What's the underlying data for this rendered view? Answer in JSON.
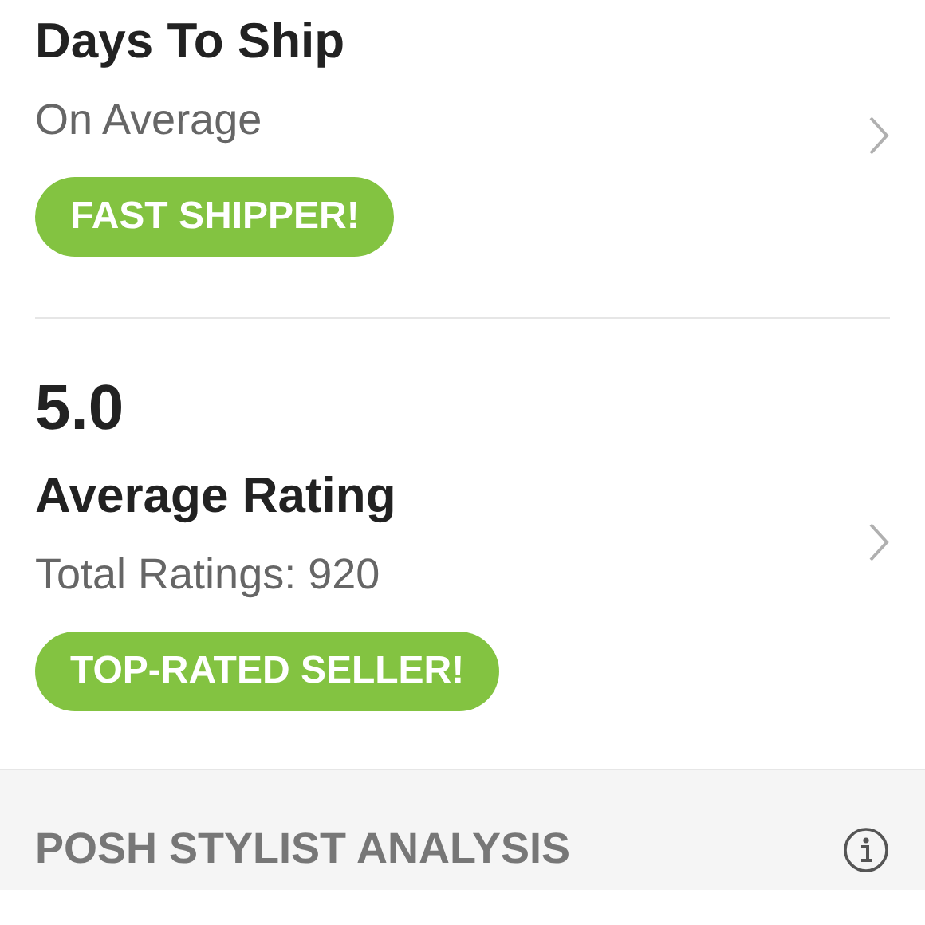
{
  "stats": [
    {
      "title": "Days To Ship",
      "subtitle": "On Average",
      "badge": "FAST SHIPPER!"
    },
    {
      "value": "5.0",
      "title": "Average Rating",
      "subtitle": "Total Ratings: 920",
      "badge": "TOP-RATED SELLER!"
    }
  ],
  "analysis": {
    "title": "POSH STYLIST ANALYSIS"
  }
}
